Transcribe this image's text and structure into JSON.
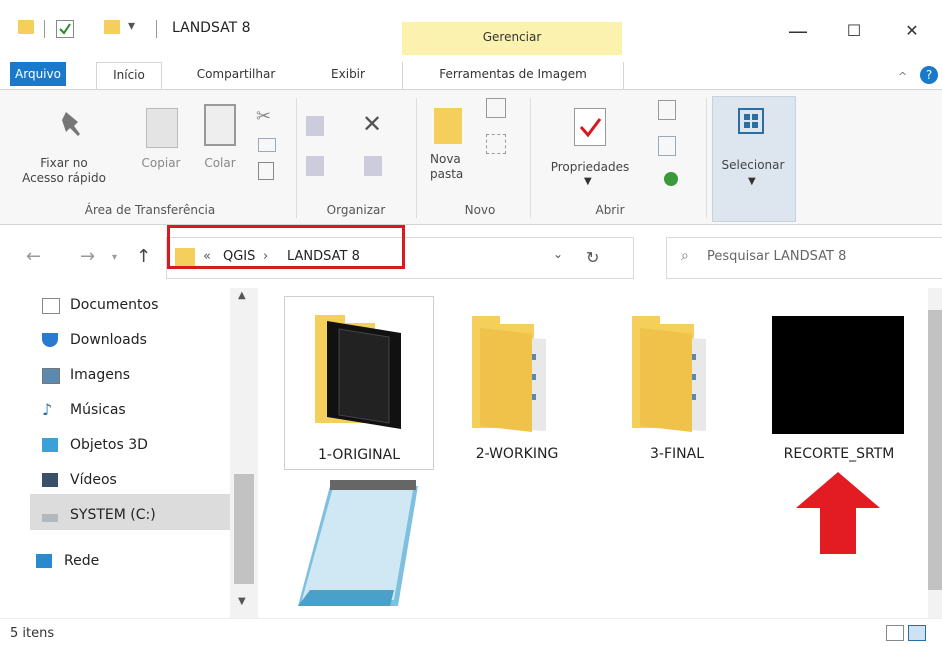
{
  "window": {
    "title": "LANDSAT 8",
    "contextual_group": "Gerenciar",
    "minimize": "—",
    "maximize": "☐",
    "close": "✕"
  },
  "ribbon_tabs": {
    "file": "Arquivo",
    "home": "Início",
    "share": "Compartilhar",
    "view": "Exibir",
    "tools": "Ferramentas de Imagem"
  },
  "ribbon": {
    "pin": "Fixar no\nAcesso rápido",
    "copy": "Copiar",
    "paste": "Colar",
    "new_folder": "Nova\npasta",
    "properties": "Propriedades",
    "select": "Selecionar",
    "groups": {
      "clipboard": "Área de Transferência",
      "organize": "Organizar",
      "new": "Novo",
      "open": "Abrir"
    }
  },
  "address": {
    "crumbs": [
      "«",
      "QGIS",
      "›",
      "LANDSAT 8"
    ],
    "search_placeholder": "Pesquisar LANDSAT 8"
  },
  "nav_items": [
    {
      "label": "Documentos",
      "icon": "documents-icon"
    },
    {
      "label": "Downloads",
      "icon": "downloads-icon"
    },
    {
      "label": "Imagens",
      "icon": "pictures-icon"
    },
    {
      "label": "Músicas",
      "icon": "music-icon"
    },
    {
      "label": "Objetos 3D",
      "icon": "3d-objects-icon"
    },
    {
      "label": "Vídeos",
      "icon": "videos-icon"
    },
    {
      "label": "SYSTEM (C:)",
      "icon": "drive-icon"
    },
    {
      "label": "Rede",
      "icon": "network-icon"
    }
  ],
  "files": [
    {
      "name": "1-ORIGINAL",
      "icon": "folder-dark-icon"
    },
    {
      "name": "2-WORKING",
      "icon": "folder-icon"
    },
    {
      "name": "3-FINAL",
      "icon": "folder-icon"
    },
    {
      "name": "RECORTE_SRTM",
      "icon": "black-image-thumbnail"
    },
    {
      "name": "",
      "icon": "notepad-icon"
    }
  ],
  "status": {
    "count": "5 itens"
  },
  "colors": {
    "accent": "#1979ca",
    "highlight": "#d71920",
    "folder": "#f5cf5b",
    "contextual": "#fbf2b0"
  }
}
